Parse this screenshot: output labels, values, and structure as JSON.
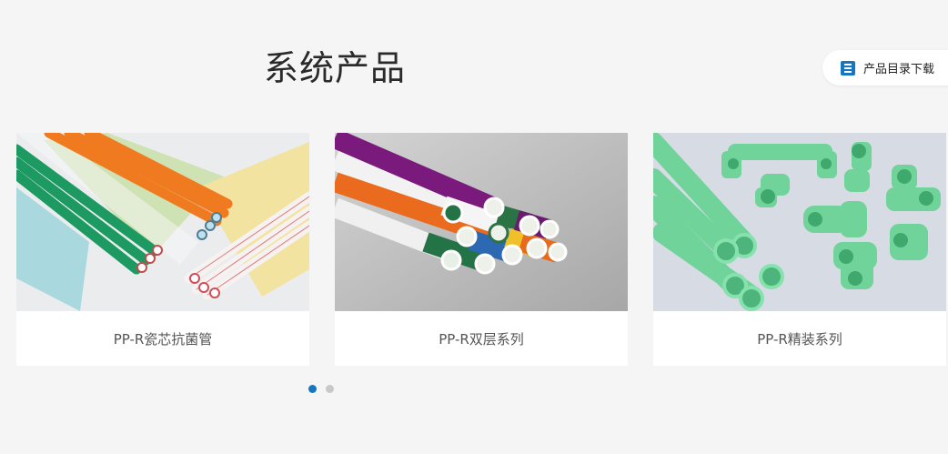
{
  "section": {
    "title": "系统产品"
  },
  "catalog": {
    "label": "产品目录下载",
    "icon": "document-list-icon",
    "accent": "#1577c1"
  },
  "products": [
    {
      "name": "PP-R瓷芯抗菌管",
      "image": "colored-pipes-photo"
    },
    {
      "name": "PP-R双层系列",
      "image": "double-layer-pipes-photo"
    },
    {
      "name": "PP-R精装系列",
      "image": "green-fittings-photo"
    }
  ],
  "pagination": {
    "total": 2,
    "active": 1,
    "active_color": "#1577c1",
    "inactive_color": "#c8c8c8"
  }
}
